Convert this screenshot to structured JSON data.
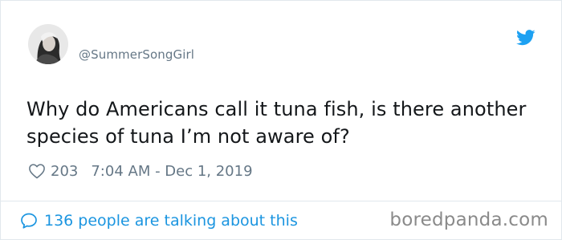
{
  "tweet": {
    "handle": "@SummerSongGirl",
    "text": "Why do Americans call it tuna fish, is there another species of tuna I’m not aware of?",
    "likes": "203",
    "timestamp": "7:04 AM - Dec 1, 2019"
  },
  "footer": {
    "talking_text": "136 people are talking about this"
  },
  "watermark": "boredpanda.com",
  "icons": {
    "brand": "twitter-bird-icon",
    "like": "heart-icon",
    "comment": "speech-bubble-icon"
  },
  "colors": {
    "twitter_blue": "#1da1f2",
    "link_blue": "#1b95e0",
    "secondary_text": "#657786",
    "primary_text": "#14171a",
    "border": "#e1e8ed",
    "watermark": "#8a8a8a"
  }
}
